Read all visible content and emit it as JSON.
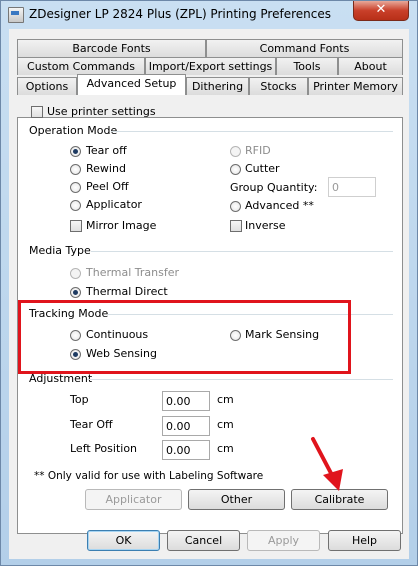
{
  "window": {
    "title": "ZDesigner LP 2824 Plus (ZPL) Printing Preferences",
    "close_label": "✕"
  },
  "tabs": {
    "row1": [
      "Barcode Fonts",
      "Command Fonts"
    ],
    "row2": [
      "Custom Commands",
      "Import/Export settings",
      "Tools",
      "About"
    ],
    "row3": [
      "Options",
      "Advanced Setup",
      "Dithering",
      "Stocks",
      "Printer Memory"
    ],
    "active": "Advanced Setup"
  },
  "use_printer_settings": {
    "label": "Use printer settings",
    "checked": false
  },
  "operation_mode": {
    "title": "Operation Mode",
    "left": [
      {
        "label": "Tear off",
        "selected": true
      },
      {
        "label": "Rewind",
        "selected": false
      },
      {
        "label": "Peel Off",
        "selected": false
      },
      {
        "label": "Applicator",
        "selected": false
      }
    ],
    "right": [
      {
        "label": "RFID",
        "selected": false,
        "disabled": true
      },
      {
        "label": "Cutter",
        "selected": false
      }
    ],
    "group_quantity_label": "Group Quantity:",
    "group_quantity_value": "0",
    "advanced_label": "Advanced **",
    "mirror_image_label": "Mirror Image",
    "inverse_label": "Inverse"
  },
  "media_type": {
    "title": "Media Type",
    "options": [
      {
        "label": "Thermal Transfer",
        "selected": false,
        "disabled": true
      },
      {
        "label": "Thermal Direct",
        "selected": true
      }
    ]
  },
  "tracking_mode": {
    "title": "Tracking Mode",
    "continuous_label": "Continuous",
    "mark_sensing_label": "Mark Sensing",
    "web_sensing_label": "Web Sensing",
    "selected": "Web Sensing"
  },
  "adjustment": {
    "title": "Adjustment",
    "rows": [
      {
        "label": "Top",
        "value": "0.00",
        "unit": "cm"
      },
      {
        "label": "Tear Off",
        "value": "0.00",
        "unit": "cm"
      },
      {
        "label": "Left Position",
        "value": "0.00",
        "unit": "cm"
      }
    ]
  },
  "footnote": "** Only valid for use with Labeling Software",
  "panel_buttons": {
    "applicator": "Applicator",
    "other": "Other",
    "calibrate": "Calibrate"
  },
  "dialog_buttons": {
    "ok": "OK",
    "cancel": "Cancel",
    "apply": "Apply",
    "help": "Help"
  },
  "colors": {
    "highlight_box": "#e0141c",
    "arrow": "#e0141c"
  }
}
